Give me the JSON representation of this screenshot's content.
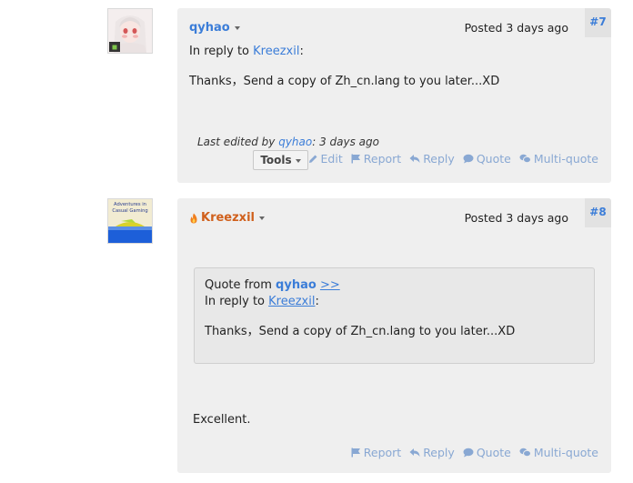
{
  "posts": [
    {
      "number": "#7",
      "author": "qyhao",
      "posted": "Posted 3 days ago",
      "reply_prefix": "In reply to ",
      "reply_to": "Kreezxil",
      "reply_suffix": ":",
      "body": "Thanks，Send a copy of Zh_cn.lang to you later...XD",
      "edited_prefix": "Last edited by ",
      "edited_by": "qyhao",
      "edited_suffix": ": 3 days ago",
      "tools_label": "Tools",
      "actions": {
        "edit": "Edit",
        "report": "Report",
        "reply": "Reply",
        "quote": "Quote",
        "multiquote": "Multi-quote"
      }
    },
    {
      "number": "#8",
      "author": "Kreezxil",
      "posted": "Posted 3 days ago",
      "avatar_text": "Adventures in Casual Gaming",
      "quote": {
        "from_prefix": "Quote from ",
        "from_author": "qyhao",
        "from_link": ">>",
        "reply_prefix": "In reply to ",
        "reply_to": "Kreezxil",
        "reply_suffix": ":",
        "body": "Thanks，Send a copy of Zh_cn.lang to you later...XD"
      },
      "body": "Excellent.",
      "actions": {
        "report": "Report",
        "reply": "Reply",
        "quote": "Quote",
        "multiquote": "Multi-quote"
      }
    }
  ],
  "colors": {
    "link": "#3b7dd8",
    "action": "#89a8d3",
    "author_orange": "#d0601c",
    "post_bg": "#efefef"
  }
}
